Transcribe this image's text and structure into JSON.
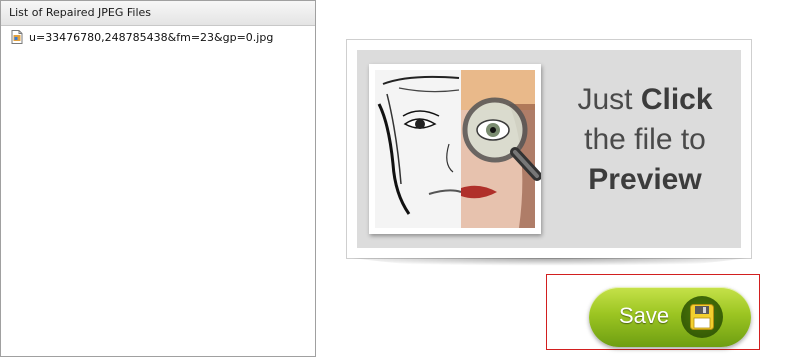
{
  "file_list": {
    "header": "List of Repaired JPEG Files",
    "items": [
      {
        "name": "u=33476780,248785438&fm=23&gp=0.jpg",
        "icon": "jpeg-file-icon"
      }
    ]
  },
  "preview": {
    "line1_prefix": "Just ",
    "line1_bold": "Click",
    "line2": "the file to",
    "line3_bold": "Preview",
    "image_icon": "magnifier-icon"
  },
  "save": {
    "label": "Save",
    "icon": "floppy-disk-icon",
    "highlight_color": "#d21f1f",
    "button_color": "#9cc522"
  }
}
